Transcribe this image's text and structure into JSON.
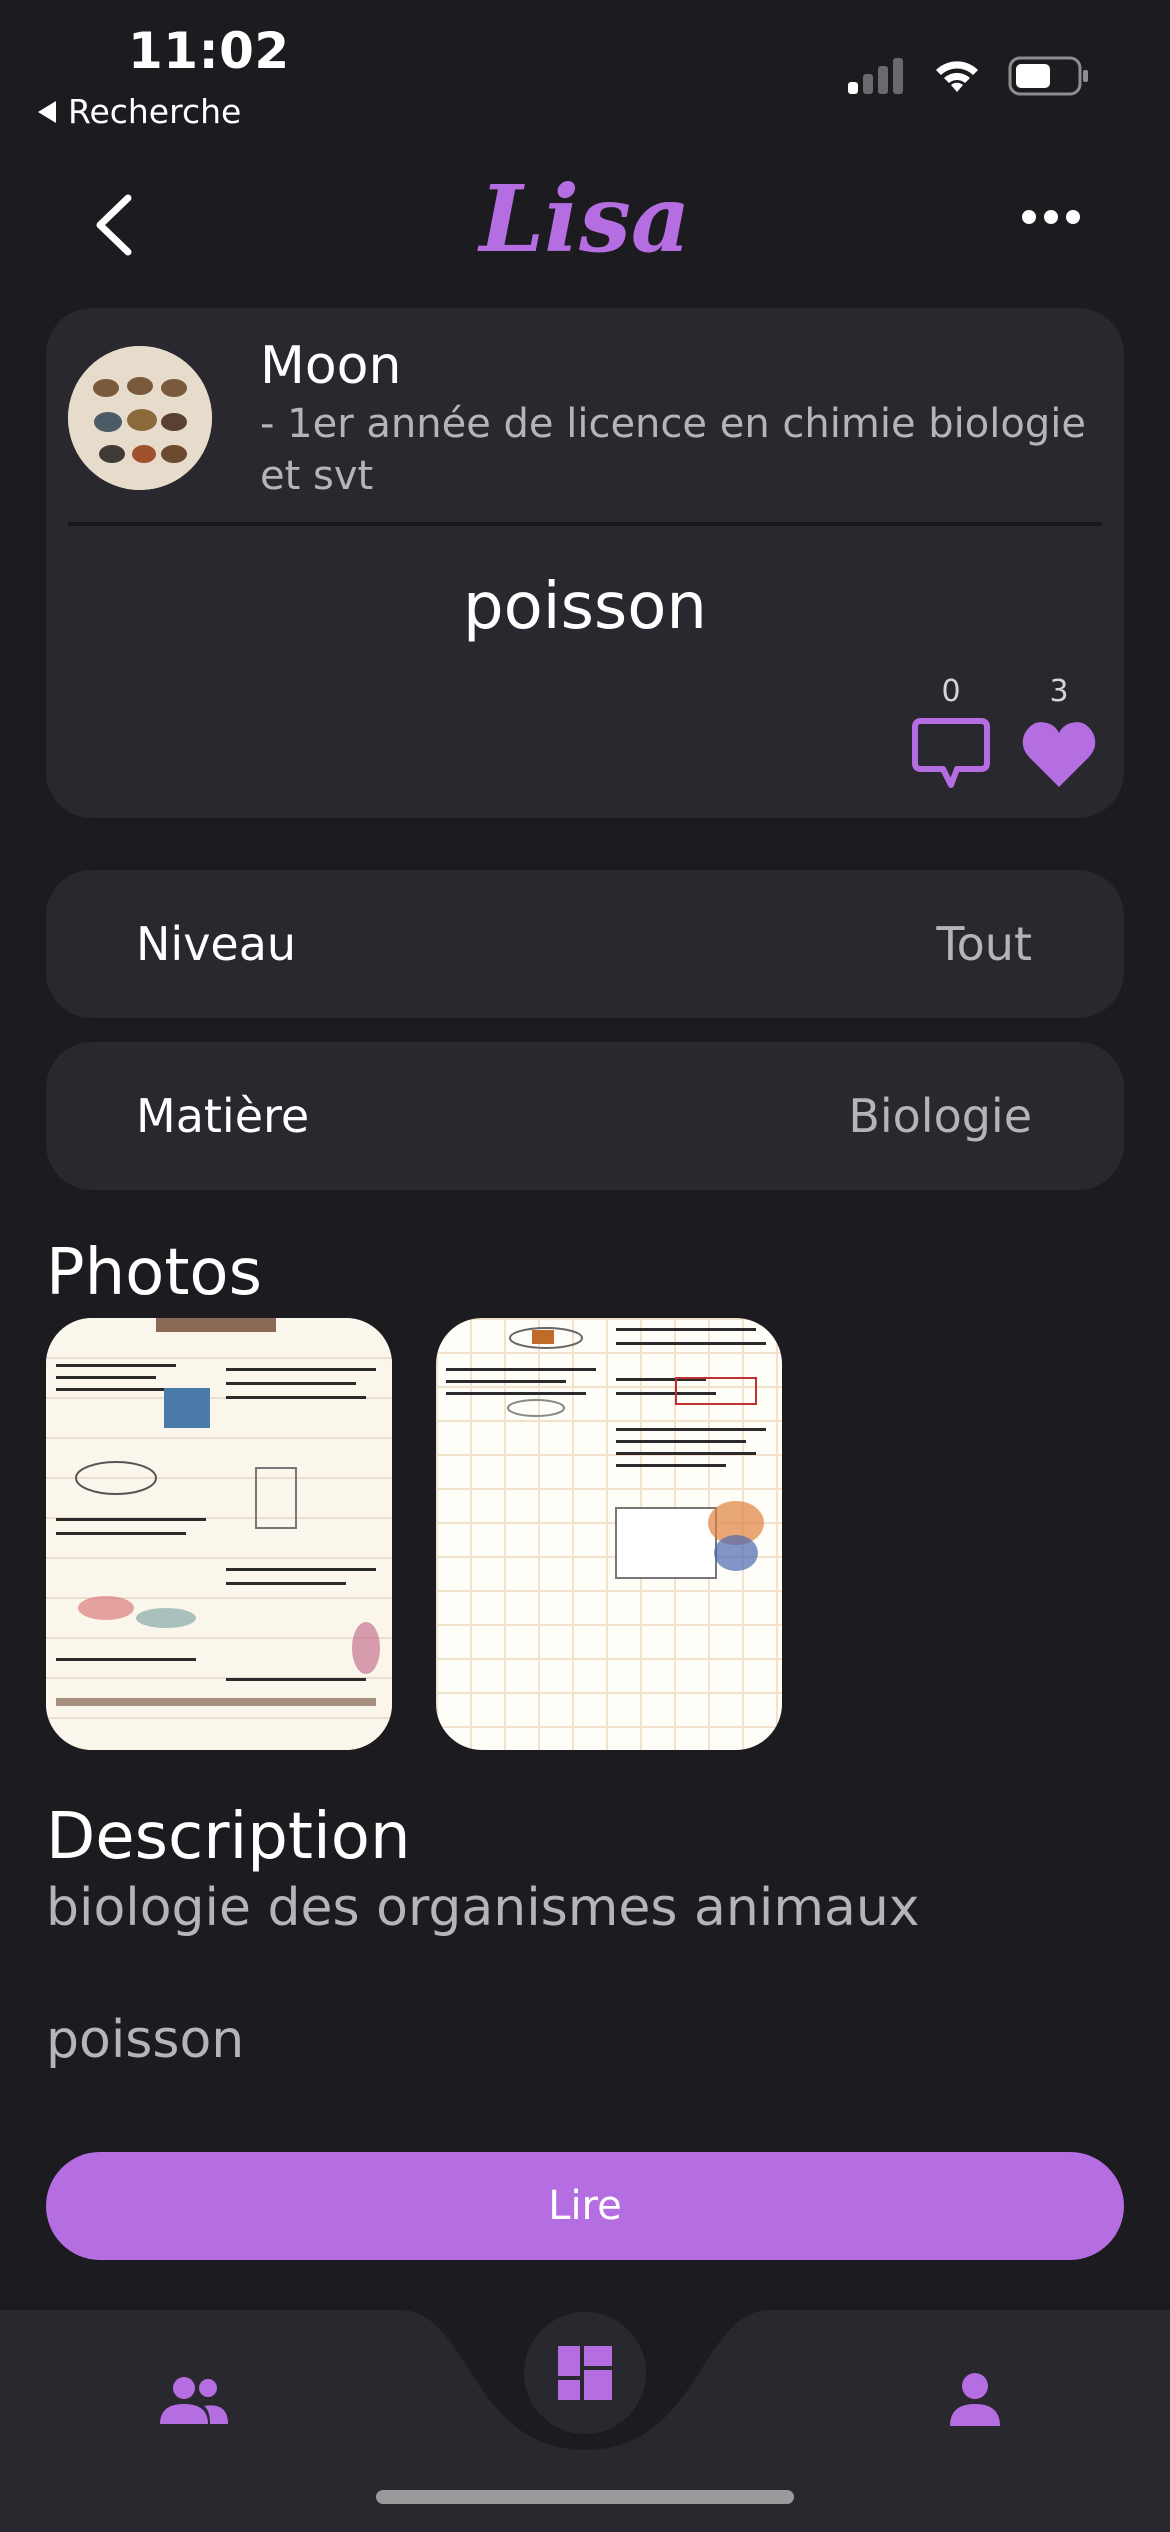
{
  "status_bar": {
    "time": "11:02",
    "back_app": "Recherche",
    "icons": [
      "cellular-signal-icon",
      "wifi-icon",
      "battery-icon"
    ]
  },
  "nav": {
    "title": "Lisa",
    "back_icon": "chevron-left-icon",
    "more_icon": "more-horizontal-icon"
  },
  "author": {
    "name": "Moon",
    "subtitle": "- 1er année de licence en chimie biologie et svt"
  },
  "note": {
    "title": "poisson",
    "comments_count": "0",
    "likes_count": "3"
  },
  "details": {
    "level_label": "Niveau",
    "level_value": "Tout",
    "subject_label": "Matière",
    "subject_value": "Biologie"
  },
  "photos": {
    "heading": "Photos"
  },
  "description": {
    "heading": "Description",
    "text": "biologie des organismes animaux",
    "extra": "poisson"
  },
  "actions": {
    "read_label": "Lire"
  },
  "tabbar": {
    "items": [
      "community-icon",
      "dashboard-icon",
      "profile-icon"
    ]
  },
  "colors": {
    "accent": "#b56de2",
    "background": "#1c1b20",
    "card": "#29282e"
  }
}
